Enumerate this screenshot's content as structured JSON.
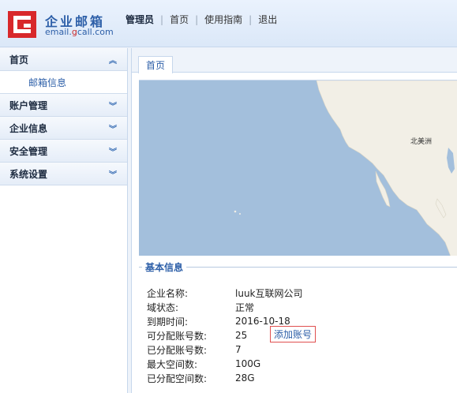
{
  "brand": {
    "title": "企业邮箱",
    "subtitle_pre": "email.",
    "subtitle_accent": "g",
    "subtitle_post": "call.com"
  },
  "topnav": {
    "user": "管理员",
    "links": [
      "首页",
      "使用指南",
      "退出"
    ]
  },
  "sidebar": {
    "groups": [
      {
        "label": "首页",
        "icon": "chevron-up-double"
      },
      {
        "label": "账户管理",
        "icon": "chevron-down-double"
      },
      {
        "label": "企业信息",
        "icon": "chevron-down-double"
      },
      {
        "label": "安全管理",
        "icon": "chevron-down-double"
      },
      {
        "label": "系统设置",
        "icon": "chevron-down-double"
      }
    ],
    "sub_items": [
      "邮箱信息"
    ]
  },
  "main": {
    "tab": "首页",
    "map_label": "北美洲"
  },
  "info": {
    "title": "基本信息",
    "rows": [
      {
        "key": "企业名称:",
        "value": "luuk互联网公司"
      },
      {
        "key": "域状态:",
        "value": "正常"
      },
      {
        "key": "到期时间:",
        "value": "2016-10-18"
      },
      {
        "key": "可分配账号数:",
        "value": "25"
      },
      {
        "key": "已分配账号数:",
        "value": "7"
      },
      {
        "key": "最大空间数:",
        "value": "100G"
      },
      {
        "key": "已分配空间数:",
        "value": "28G"
      }
    ],
    "add_button": "添加账号"
  },
  "colors": {
    "brand_red": "#d8282b",
    "brand_blue": "#2d5fa8",
    "map_water": "#a3bfdc",
    "map_land": "#f2efe6"
  }
}
